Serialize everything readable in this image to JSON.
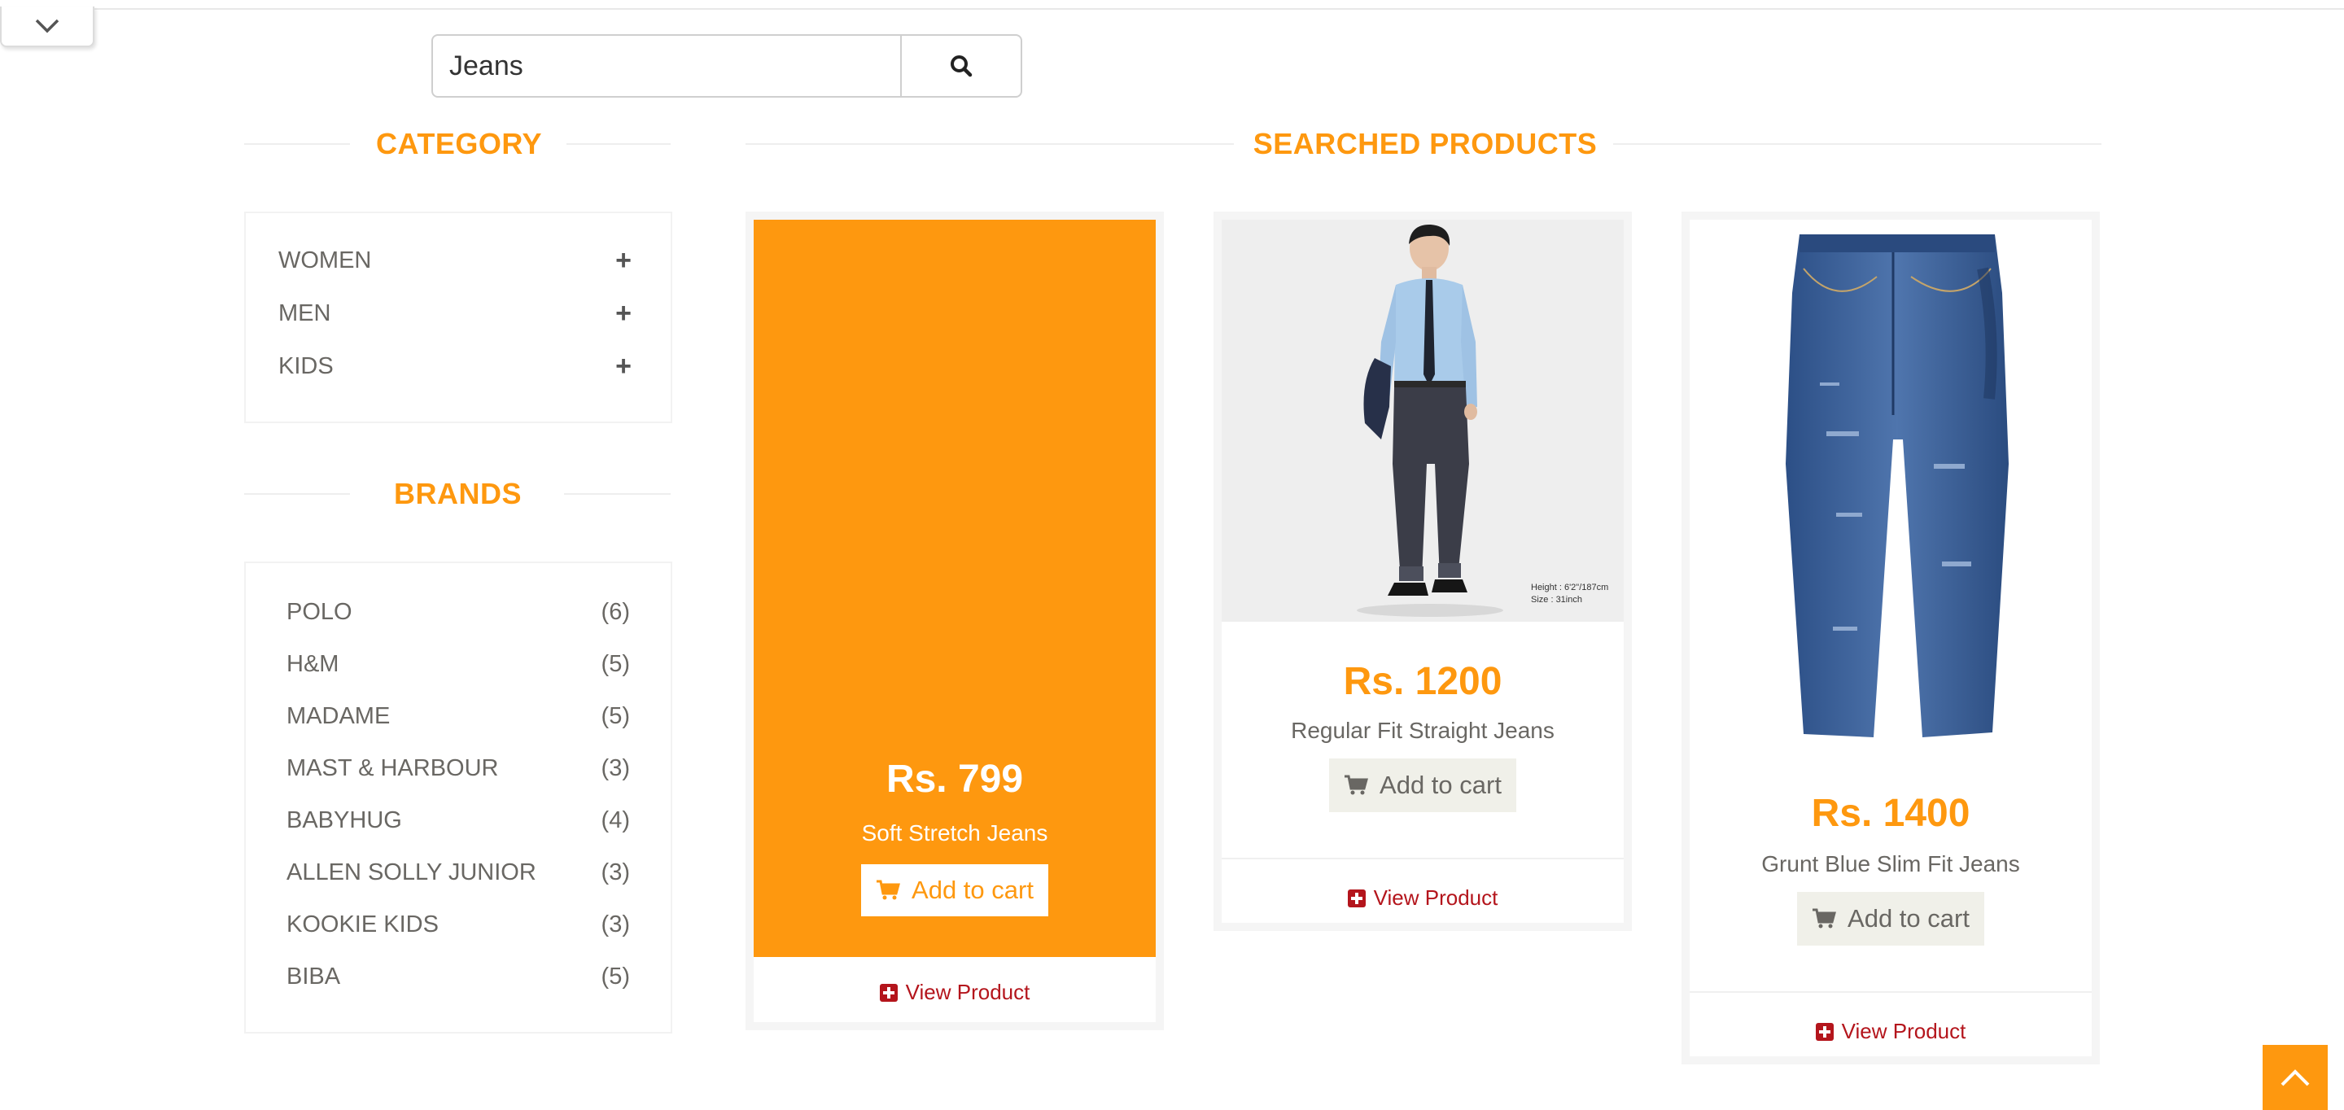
{
  "search": {
    "value": "Jeans"
  },
  "category": {
    "title": "CATEGORY",
    "items": [
      {
        "label": "WOMEN"
      },
      {
        "label": "MEN"
      },
      {
        "label": "KIDS"
      }
    ]
  },
  "brands": {
    "title": "BRANDS",
    "items": [
      {
        "name": "POLO",
        "count": "(6)"
      },
      {
        "name": "H&M",
        "count": "(5)"
      },
      {
        "name": "MADAME",
        "count": "(5)"
      },
      {
        "name": "MAST & HARBOUR",
        "count": "(3)"
      },
      {
        "name": "BABYHUG",
        "count": "(4)"
      },
      {
        "name": "ALLEN SOLLY JUNIOR",
        "count": "(3)"
      },
      {
        "name": "KOOKIE KIDS",
        "count": "(3)"
      },
      {
        "name": "BIBA",
        "count": "(5)"
      }
    ]
  },
  "products": {
    "title": "SEARCHED PRODUCTS",
    "items": [
      {
        "price": "Rs. 799",
        "name": "Soft Stretch Jeans",
        "cart_label": "Add to cart",
        "view_label": "View Product"
      },
      {
        "price": "Rs. 1200",
        "name": "Regular Fit Straight Jeans",
        "cart_label": "Add to cart",
        "view_label": "View Product",
        "image_caption_1": "Height : 6'2\"/187cm",
        "image_caption_2": "Size : 31inch"
      },
      {
        "price": "Rs. 1400",
        "name": "Grunt Blue Slim Fit Jeans",
        "cart_label": "Add to cart",
        "view_label": "View Product"
      }
    ]
  },
  "colors": {
    "accent": "#fe980f",
    "link": "#b4151c",
    "text": "#696763",
    "button_bg": "#f0f0e9"
  }
}
